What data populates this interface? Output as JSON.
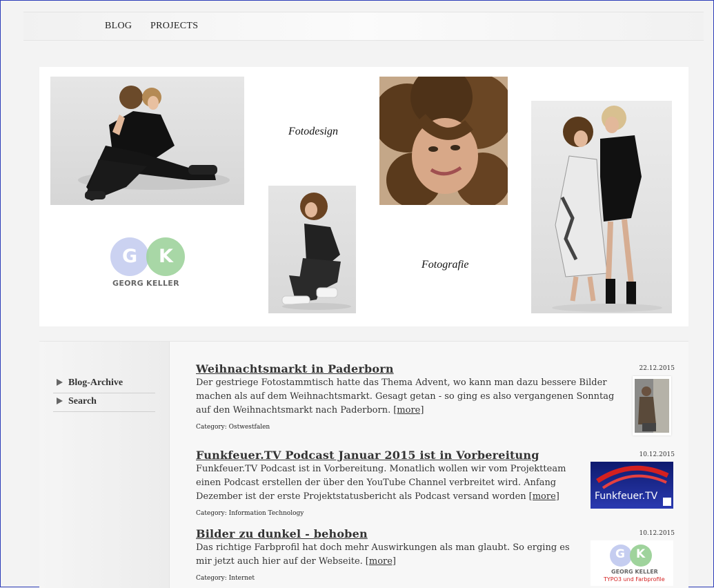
{
  "nav": {
    "items": [
      "BLOG",
      "PROJECTS"
    ]
  },
  "hero": {
    "text1": "Fotodesign",
    "text2": "Fotografie",
    "logo": {
      "letter1": "G",
      "letter2": "K",
      "name": "GEORG KELLER"
    }
  },
  "sidebar": {
    "items": [
      "Blog-Archive",
      "Search"
    ]
  },
  "posts": [
    {
      "title": "Weihnachtsmarkt in Paderborn",
      "body": "Der gestriege Fotostammtisch hatte das Thema Advent, wo kann man dazu bessere Bilder machen als auf dem Weihnachtsmarkt. Gesagt getan - so ging es also vergangenen Sonntag auf den Weihnachtsmarkt nach Paderborn.",
      "more": "[more]",
      "category": "Category: Ostwestfalen",
      "date": "22.12.2015"
    },
    {
      "title": "Funkfeuer.TV Podcast Januar 2015 ist in Vorbereitung",
      "body": "Funkfeuer.TV Podcast ist in Vorbereitung. Monatlich wollen wir vom Projektteam einen Podcast erstellen der über den YouTube Channel verbreitet wird. Anfang Dezember ist der erste Projektstatusbericht als Podcast versand worden",
      "more": "[more]",
      "category": "Category: Information Technology",
      "date": "10.12.2015",
      "thumb_text": "Funkfeuer.TV"
    },
    {
      "title": "Bilder zu dunkel - behoben",
      "body": "Das richtige Farbprofil hat doch mehr Auswirkungen als man glaubt. So erging es mir jetzt auch hier auf der Webseite.",
      "more": "[more]",
      "category": "Category: Internet",
      "date": "10.12.2015",
      "thumb_name": "GEORG KELLER",
      "thumb_sub": "TYPO3 und Farbprofile"
    }
  ],
  "colors": {
    "frame": "#2b3bb8",
    "logo_g": "#c5cdf0",
    "logo_k": "#9fd39c",
    "funk_blue": "#1a2a8c",
    "funk_red": "#d42020"
  }
}
